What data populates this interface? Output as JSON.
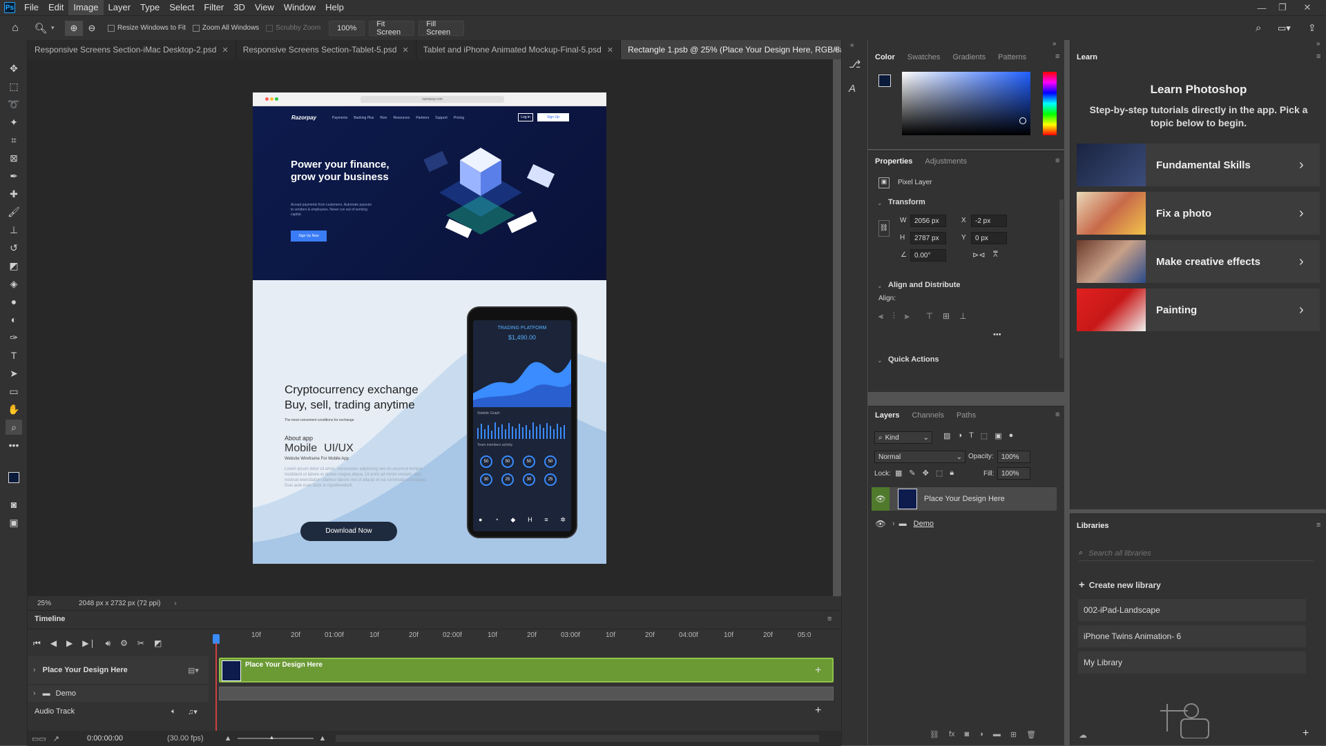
{
  "app": {
    "logo": "Ps"
  },
  "menu": [
    "File",
    "Edit",
    "Image",
    "Layer",
    "Type",
    "Select",
    "Filter",
    "3D",
    "View",
    "Window",
    "Help"
  ],
  "options": {
    "resize_windows": "Resize Windows to Fit",
    "zoom_all": "Zoom All Windows",
    "scrubby": "Scrubby Zoom",
    "zoom_value": "100%",
    "fit_screen": "Fit Screen",
    "fill_screen": "Fill Screen"
  },
  "doc_tabs": [
    {
      "label": "Responsive Screens Section-iMac Desktop-2.psd"
    },
    {
      "label": "Responsive Screens Section-Tablet-5.psd"
    },
    {
      "label": "Tablet and iPhone Animated Mockup-Final-5.psd"
    },
    {
      "label": "Rectangle 1.psb @ 25% (Place Your Design Here, RGB/8#)"
    }
  ],
  "status": {
    "zoom": "25%",
    "doc_size": "2048 px x 2732 px (72 ppi)"
  },
  "canvas": {
    "browser_url": "razorpay.com",
    "brand": "Razorpay",
    "nav": [
      "Payments",
      "Banking Plus",
      "Rize",
      "Resources",
      "Partners",
      "Support",
      "Pricing"
    ],
    "login": "Log in",
    "signup": "Sign Up",
    "hero_title_1": "Power your finance,",
    "hero_title_2": "grow your business",
    "hero_body": "Accept payments from customers. Automate payouts to vendors & employees. Never run out of working capital.",
    "hero_cta": "Sign Up Now",
    "crypto_title_1": "Cryptocurrency exchange",
    "crypto_title_2": "Buy, sell, trading anytime",
    "crypto_sub": "The most convenient conditions for exchange",
    "about": "About app",
    "mobile": "Mobile",
    "uiux": "UI/UX",
    "wireframe": "Website Wireframe For Mobile App",
    "lorem": "Lorem ipsum dolor sit amet, consectetur adipiscing sed do eiusmod tempor incididunt ut labore et dolore magna aliqua. Ut enim ad minim veniam, quis nostrud exercitation ullamco laboris nisi ut aliquip ex ea commodo consequat. Duis aute irure dolor in reprehenderit",
    "download": "Download Now",
    "phone_title": "TRADING PLATFORM",
    "phone_amount": "$1,490.00",
    "phone_graph": "Statistic Graph",
    "phone_team": "Team members activity",
    "phone_values": [
      "50",
      "50",
      "50",
      "50",
      "30",
      "25",
      "30",
      "25"
    ]
  },
  "timeline": {
    "title": "Timeline",
    "ruler": [
      "10f",
      "20f",
      "01:00f",
      "10f",
      "20f",
      "02:00f",
      "10f",
      "20f",
      "03:00f",
      "10f",
      "20f",
      "04:00f",
      "10f",
      "20f",
      "05:0"
    ],
    "tracks": [
      {
        "label": "Place Your Design Here"
      },
      {
        "label": "Demo"
      },
      {
        "label": "Audio Track"
      }
    ],
    "clip_label": "Place Your Design Here",
    "time": "0:00:00:00",
    "fps": "(30.00 fps)"
  },
  "color_panel": {
    "tabs": [
      "Color",
      "Swatches",
      "Gradients",
      "Patterns"
    ]
  },
  "properties": {
    "tabs": [
      "Properties",
      "Adjustments"
    ],
    "kind": "Pixel Layer",
    "transform": "Transform",
    "w_label": "W",
    "w": "2056 px",
    "h_label": "H",
    "h": "2787 px",
    "x_label": "X",
    "x": "-2 px",
    "y_label": "Y",
    "y": "0 px",
    "angle": "0.00°",
    "align_title": "Align and Distribute",
    "align_label": "Align:",
    "quick_actions": "Quick Actions"
  },
  "layers": {
    "tabs": [
      "Layers",
      "Channels",
      "Paths"
    ],
    "kind": "Kind",
    "blend": "Normal",
    "opacity_label": "Opacity:",
    "opacity": "100%",
    "lock_label": "Lock:",
    "fill_label": "Fill:",
    "fill": "100%",
    "items": [
      {
        "name": "Place Your Design Here"
      },
      {
        "name": "Demo"
      }
    ]
  },
  "learn": {
    "tab": "Learn",
    "title": "Learn Photoshop",
    "subtitle": "Step-by-step tutorials directly in the app. Pick a topic below to begin.",
    "cards": [
      {
        "label": "Fundamental Skills"
      },
      {
        "label": "Fix a photo"
      },
      {
        "label": "Make creative effects"
      },
      {
        "label": "Painting"
      }
    ]
  },
  "libraries": {
    "tab": "Libraries",
    "search_placeholder": "Search all libraries",
    "create": "Create new library",
    "items": [
      {
        "name": "002-iPad-Landscape"
      },
      {
        "name": "iPhone Twins Animation- 6"
      },
      {
        "name": "My Library"
      }
    ]
  },
  "colors": {
    "accent": "#31a8ff",
    "clip_green": "#6b9a35",
    "hero_bg": "#0b1a47"
  }
}
